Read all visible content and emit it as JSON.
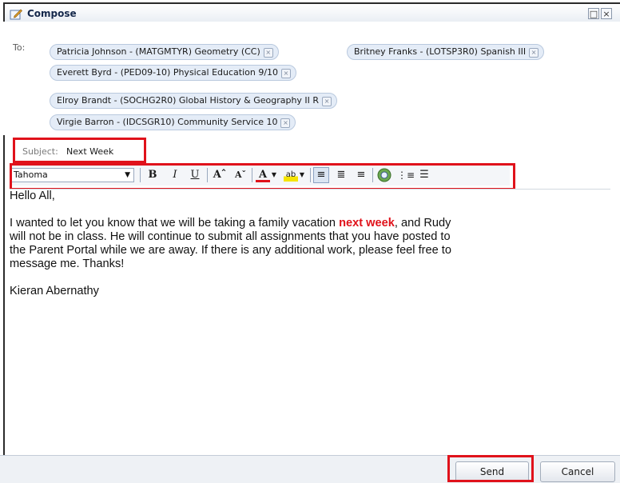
{
  "window": {
    "title": "Compose",
    "maximize_glyph": "□",
    "close_glyph": "×"
  },
  "to": {
    "label": "To:",
    "recipients": [
      "Patricia Johnson - (MATGMTYR) Geometry (CC)",
      "Britney Franks - (LOTSP3R0) Spanish III",
      "Everett Byrd - (PED09-10) Physical Education 9/10",
      "Elroy Brandt - (SOCHG2R0) Global History & Geography II R",
      "Virgie Barron - (IDCSGR10) Community Service 10"
    ]
  },
  "subject": {
    "label": "Subject:",
    "value": "Next Week"
  },
  "toolbar": {
    "font": "Tahoma",
    "bold": "B",
    "italic": "I",
    "underline": "U",
    "grow": "Aˆ",
    "shrink": "Aˇ",
    "font_color": "A",
    "highlight": "ab",
    "align_left": "≡",
    "align_center": "≣",
    "align_right": "≡",
    "bullets": "☰"
  },
  "body": {
    "greeting": "Hello All,",
    "para_before": "I wanted to let you know that we will be taking a family vacation ",
    "para_highlight": "next week",
    "para_line1_after": ", and Rudy",
    "para_line2": "will not be in class.  He will continue to submit all assignments that you have posted to",
    "para_line3": "the Parent Portal while we are away.  If there is any additional work, please feel free to",
    "para_line4": "message me.  Thanks!",
    "signature": "Kieran Abernathy"
  },
  "buttons": {
    "send": "Send",
    "cancel": "Cancel"
  },
  "colors": {
    "annotation_red": "#e0121b",
    "chip_bg": "#e4ecf7",
    "highlight_text": "#e0121b"
  }
}
